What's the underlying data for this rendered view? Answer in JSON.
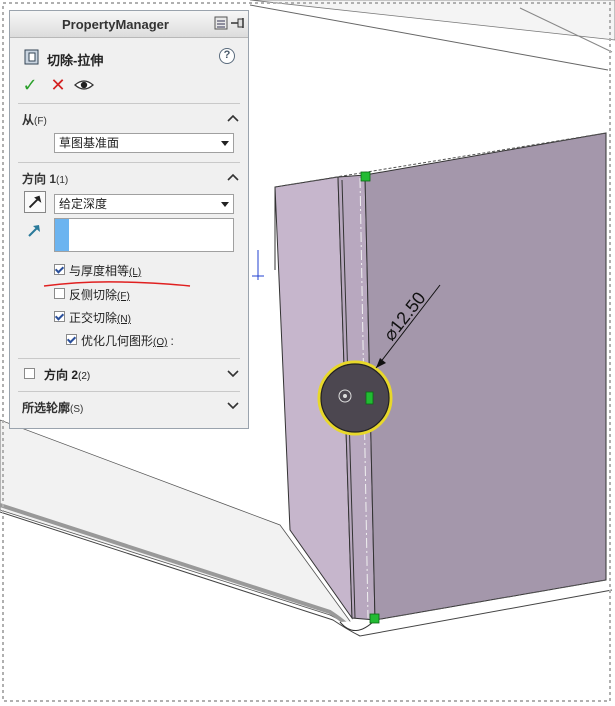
{
  "property_manager": {
    "title": "PropertyManager",
    "feature_title": "切除-拉伸",
    "help_symbol": "?",
    "actions": {
      "ok_symbol": "✓",
      "cancel_symbol": "✕",
      "preview_icon": "eye-icon"
    },
    "from": {
      "label": "从",
      "key": "(F)",
      "selected": "草图基准面"
    },
    "direction1": {
      "label": "方向 1",
      "key": "(1)",
      "end_condition": "给定深度",
      "options": [
        {
          "label": "与厚度相等",
          "key": "(L)",
          "checked": true
        },
        {
          "label": "反侧切除",
          "key": "(F)",
          "checked": false
        },
        {
          "label": "正交切除",
          "key": "(N)",
          "checked": true
        },
        {
          "label": "优化几何图形",
          "key": "(O)",
          "suffix": ":",
          "checked": true
        }
      ]
    },
    "direction2": {
      "label": "方向 2",
      "key": "(2)",
      "checked": false
    },
    "selected_contours": {
      "label": "所选轮廓",
      "key": "(S)"
    }
  },
  "model_view": {
    "dimension_label": "⌀12.50",
    "colors": {
      "face": "#a497ab",
      "face_light": "#c0b2c6",
      "hole": "#4c4750",
      "highlight": "#e8d82a",
      "handle": "#22bb33"
    }
  }
}
